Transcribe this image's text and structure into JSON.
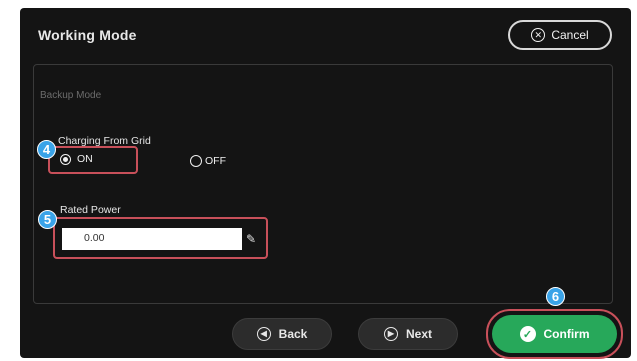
{
  "window": {
    "title": "Working Mode"
  },
  "header": {
    "cancel_label": "Cancel"
  },
  "section": {
    "label": "Backup Mode"
  },
  "charging": {
    "label": "Charging From Grid",
    "options": [
      {
        "label": "ON",
        "selected": true
      },
      {
        "label": "OFF",
        "selected": false
      }
    ]
  },
  "rated_power": {
    "label": "Rated Power",
    "value": "0.00"
  },
  "steps": {
    "four": "4",
    "five": "5",
    "six": "6"
  },
  "footer": {
    "back_label": "Back",
    "next_label": "Next",
    "confirm_label": "Confirm"
  },
  "colors": {
    "highlight": "#c8505a",
    "badge": "#3aa3e8",
    "confirm": "#27a85a",
    "background": "#141414"
  }
}
